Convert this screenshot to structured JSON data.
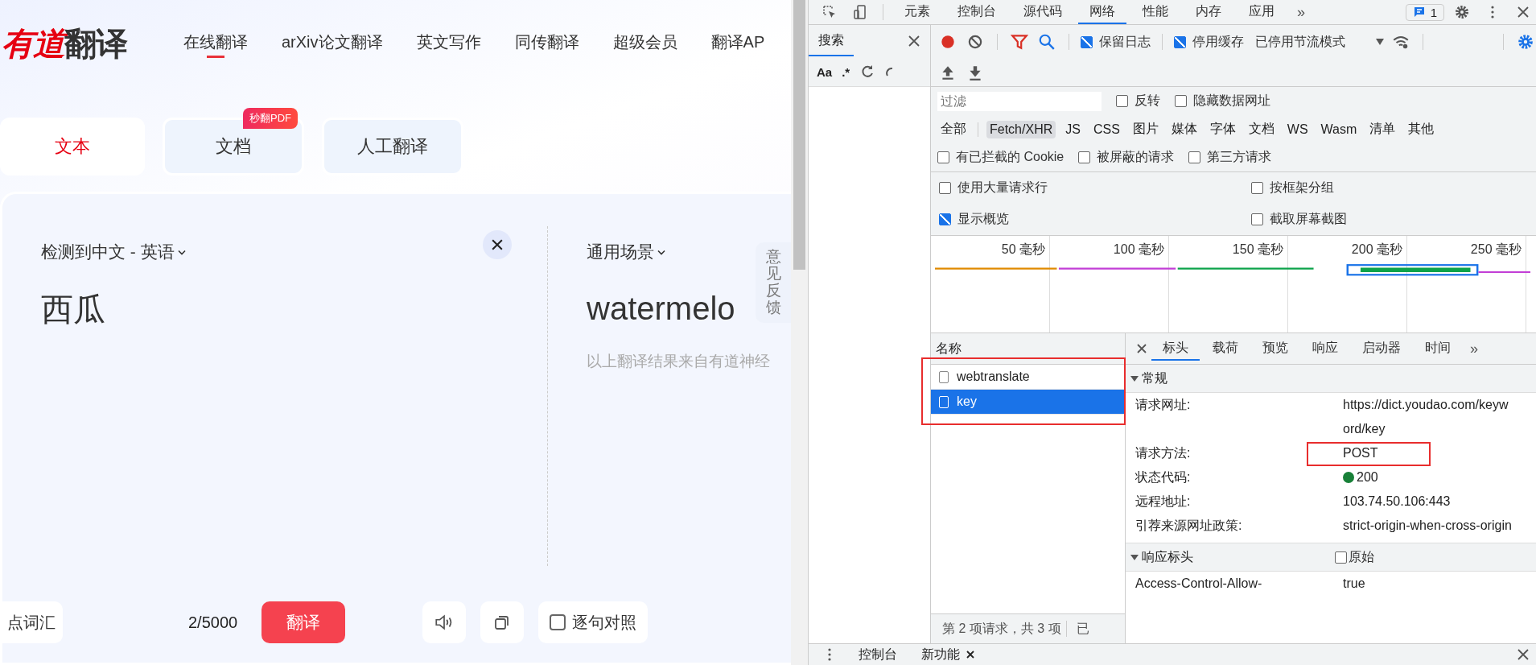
{
  "web_page": {
    "logo": {
      "brand": "有道",
      "product": "翻译"
    },
    "nav": [
      {
        "label": "在线翻译",
        "selected": true
      },
      {
        "label": "arXiv论文翻译",
        "selected": false
      },
      {
        "label": "英文写作",
        "selected": false
      },
      {
        "label": "同传翻译",
        "selected": false
      },
      {
        "label": "超级会员",
        "selected": false
      },
      {
        "label": "翻译AP",
        "selected": false
      }
    ],
    "mode_tabs": [
      {
        "label": "文本",
        "selected": true
      },
      {
        "label": "文档",
        "selected": false,
        "badge": "秒翻PDF"
      },
      {
        "label": "人工翻译",
        "selected": false
      }
    ],
    "source": {
      "language_selector": "检测到中文 - 英语",
      "text": "西瓜"
    },
    "target": {
      "scene_selector": "通用场景",
      "text": "watermelo",
      "note": "以上翻译结果来自有道神经"
    },
    "feedback_tab": "意见反馈",
    "footer": {
      "vocab_button": "点词汇",
      "char_count": "2/5000",
      "translate_button": "翻译",
      "compare_checkbox": {
        "label": "逐句对照",
        "checked": false
      }
    }
  },
  "devtools": {
    "tabs": [
      {
        "label": "元素",
        "selected": false
      },
      {
        "label": "控制台",
        "selected": false
      },
      {
        "label": "源代码",
        "selected": false
      },
      {
        "label": "网络",
        "selected": true
      },
      {
        "label": "性能",
        "selected": false
      },
      {
        "label": "内存",
        "selected": false
      },
      {
        "label": "应用",
        "selected": false
      }
    ],
    "more": "»",
    "message_count": "1",
    "search_pane": {
      "title": "搜索",
      "match_case": "Aa",
      "regex": ".*"
    },
    "toolbar": {
      "recording": true,
      "filter_active": true,
      "checkboxes": [
        {
          "label": "保留日志",
          "checked": true
        },
        {
          "label": "停用缓存",
          "checked": true
        }
      ],
      "throttling": "已停用节流模式"
    },
    "filter": {
      "placeholder": "过滤",
      "checkboxes": [
        {
          "label": "反转",
          "checked": false
        },
        {
          "label": "隐藏数据网址",
          "checked": false
        }
      ]
    },
    "type_filters": [
      {
        "label": "全部",
        "selected": false
      },
      {
        "label": "Fetch/XHR",
        "selected": true
      },
      {
        "label": "JS",
        "selected": false
      },
      {
        "label": "CSS",
        "selected": false
      },
      {
        "label": "图片",
        "selected": false
      },
      {
        "label": "媒体",
        "selected": false
      },
      {
        "label": "字体",
        "selected": false
      },
      {
        "label": "文档",
        "selected": false
      },
      {
        "label": "WS",
        "selected": false
      },
      {
        "label": "Wasm",
        "selected": false
      },
      {
        "label": "清单",
        "selected": false
      },
      {
        "label": "其他",
        "selected": false
      }
    ],
    "request_filters": [
      {
        "label": "有已拦截的 Cookie",
        "checked": false
      },
      {
        "label": "被屏蔽的请求",
        "checked": false
      },
      {
        "label": "第三方请求",
        "checked": false
      }
    ],
    "settings": [
      {
        "label": "使用大量请求行",
        "checked": false
      },
      {
        "label": "按框架分组",
        "checked": false
      },
      {
        "label": "显示概览",
        "checked": true
      },
      {
        "label": "截取屏幕截图",
        "checked": false
      }
    ],
    "overview": {
      "ticks": [
        "50 毫秒",
        "100 毫秒",
        "150 毫秒",
        "200 毫秒",
        "250 毫秒"
      ]
    },
    "requests": {
      "column": "名称",
      "rows": [
        {
          "name": "webtranslate",
          "selected": false
        },
        {
          "name": "key",
          "selected": true
        }
      ],
      "status": "第 2 项请求，共 3 项",
      "status_2": "已"
    },
    "details": {
      "tabs": [
        {
          "label": "标头",
          "selected": true
        },
        {
          "label": "载荷",
          "selected": false
        },
        {
          "label": "预览",
          "selected": false
        },
        {
          "label": "响应",
          "selected": false
        },
        {
          "label": "启动器",
          "selected": false
        },
        {
          "label": "时间",
          "selected": false
        }
      ],
      "more": "»",
      "sections": [
        {
          "title": "常规",
          "expanded": true,
          "rows": [
            {
              "label": "请求网址:",
              "value": "https://dict.youdao.com/keyword/key"
            },
            {
              "label": "请求方法:",
              "value": "POST"
            },
            {
              "label": "状态代码:",
              "value": "200",
              "status_dot": true
            },
            {
              "label": "远程地址:",
              "value": "103.74.50.106:443"
            },
            {
              "label": "引荐来源网址政策:",
              "value": "strict-origin-when-cross-origin"
            }
          ]
        },
        {
          "title": "响应标头",
          "expanded": true,
          "raw": {
            "label": "原始",
            "checked": false
          },
          "rows": [
            {
              "label": "Access-Control-Allow-",
              "value": "true"
            }
          ]
        }
      ]
    },
    "drawer": {
      "tabs": [
        {
          "label": "控制台",
          "closable": false
        },
        {
          "label": "新功能",
          "closable": true
        }
      ]
    }
  }
}
